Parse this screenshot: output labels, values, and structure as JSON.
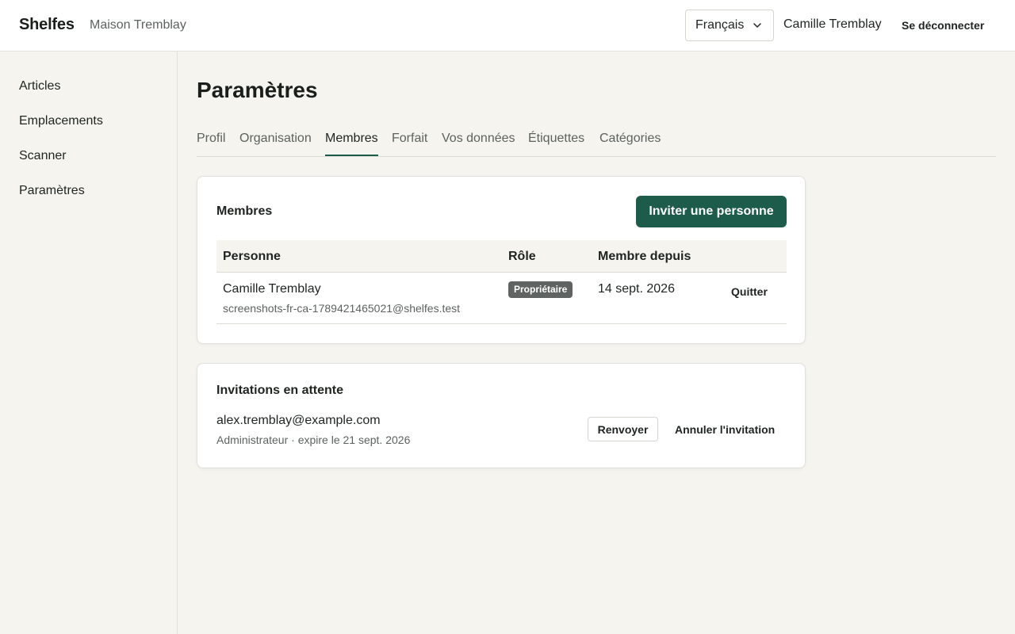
{
  "header": {
    "brand": "Shelfes",
    "organization": "Maison Tremblay",
    "language": {
      "selected": "Français",
      "icon": "chevron-down-icon"
    },
    "user_name": "Camille Tremblay",
    "logout_label": "Se déconnecter"
  },
  "sidebar": {
    "items": [
      {
        "label": "Articles"
      },
      {
        "label": "Emplacements"
      },
      {
        "label": "Scanner"
      },
      {
        "label": "Paramètres"
      }
    ]
  },
  "main": {
    "title": "Paramètres",
    "tabs": [
      {
        "label": "Profil",
        "active": false
      },
      {
        "label": "Organisation",
        "active": false
      },
      {
        "label": "Membres",
        "active": true
      },
      {
        "label": "Forfait",
        "active": false
      },
      {
        "label": "Vos données",
        "active": false
      },
      {
        "label": "Étiquettes",
        "active": false
      },
      {
        "label": "Catégories",
        "active": false
      }
    ],
    "members": {
      "title": "Membres",
      "invite_label": "Inviter une personne",
      "columns": [
        "Personne",
        "Rôle",
        "Membre depuis"
      ],
      "rows": [
        {
          "name": "Camille Tremblay",
          "email": "screenshots-fr-ca-1789421465021@shelfes.test",
          "role": "Propriétaire",
          "since": "14 sept. 2026",
          "action": "Quitter"
        }
      ]
    },
    "invitations": {
      "title": "Invitations en attente",
      "items": [
        {
          "email": "alex.tremblay@example.com",
          "meta": "Administrateur · expire le 21 sept. 2026",
          "resend_label": "Renvoyer",
          "cancel_label": "Annuler l'invitation"
        }
      ]
    }
  },
  "colors": {
    "accent": "#1d5c4a",
    "background": "#f5f4ef",
    "badge": "#5f6361"
  }
}
